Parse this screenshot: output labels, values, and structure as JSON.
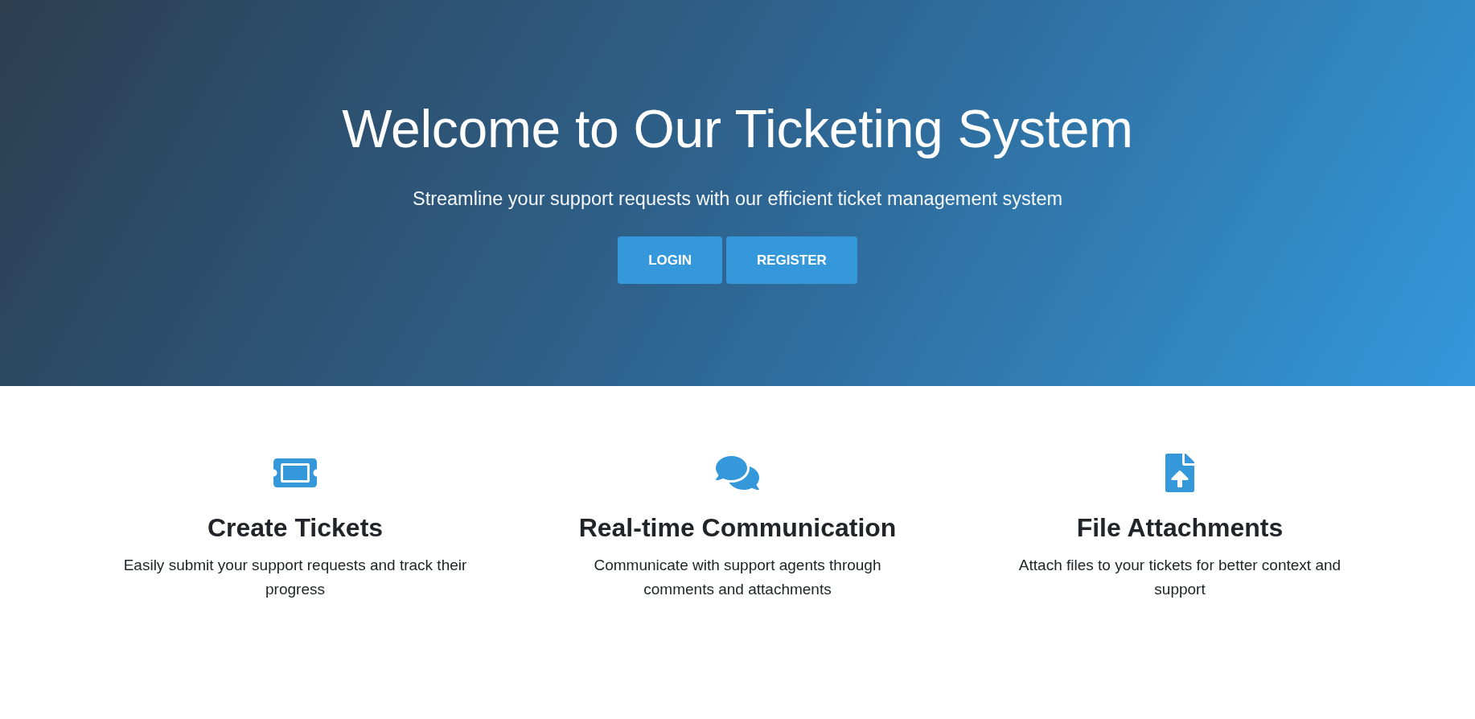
{
  "hero": {
    "title": "Welcome to Our Ticketing System",
    "subtitle": "Streamline your support requests with our efficient ticket management system",
    "buttons": [
      {
        "label": "LOGIN"
      },
      {
        "label": "REGISTER"
      }
    ]
  },
  "features": [
    {
      "title": "Create Tickets",
      "description": "Easily submit your support requests and track their progress"
    },
    {
      "title": "Real-time Communication",
      "description": "Communicate with support agents through comments and attachments"
    },
    {
      "title": "File Attachments",
      "description": "Attach files to your tickets for better context and support"
    }
  ]
}
